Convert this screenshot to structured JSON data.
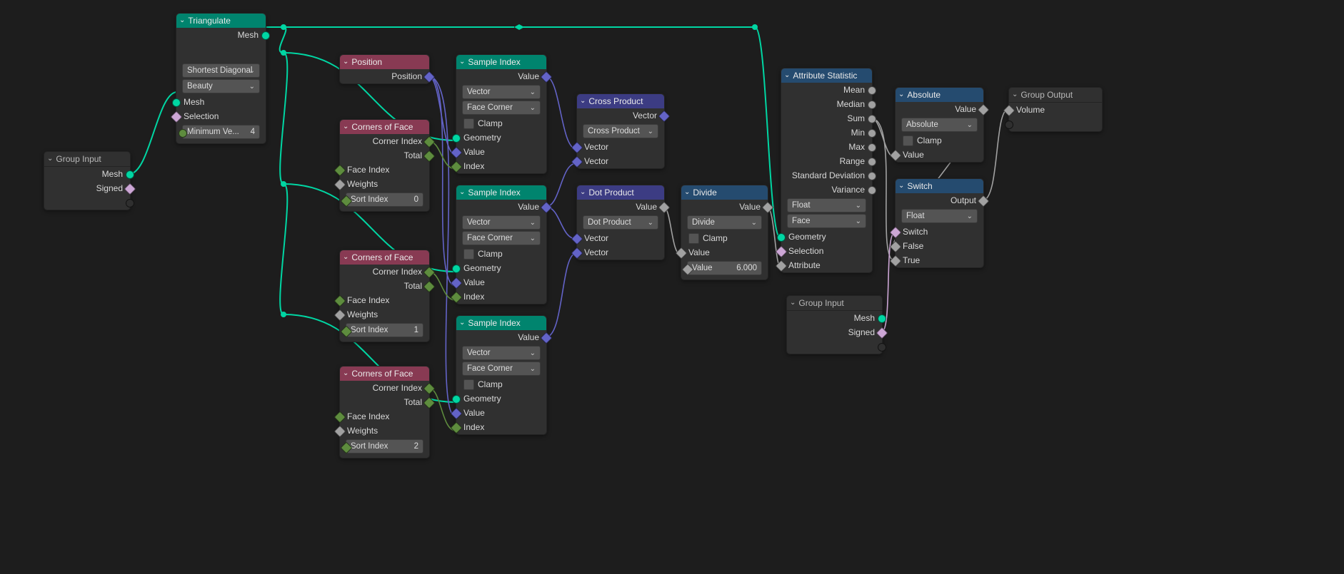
{
  "nodes": {
    "groupInput1": {
      "title": "Group Input",
      "outs": [
        "Mesh",
        "Signed"
      ]
    },
    "triangulate": {
      "title": "Triangulate",
      "outMesh": "Mesh",
      "ddQuad": "Shortest Diagonal",
      "ddNgon": "Beauty",
      "inMesh": "Mesh",
      "inSel": "Selection",
      "fieldMin": {
        "label": "Minimum Ve...",
        "value": "4"
      }
    },
    "position": {
      "title": "Position",
      "out": "Position"
    },
    "corners1": {
      "title": "Corners of Face",
      "outIdx": "Corner Index",
      "outTot": "Total",
      "inFace": "Face Index",
      "inWeights": "Weights",
      "sort": {
        "label": "Sort Index",
        "value": "0"
      }
    },
    "corners2": {
      "title": "Corners of Face",
      "outIdx": "Corner Index",
      "outTot": "Total",
      "inFace": "Face Index",
      "inWeights": "Weights",
      "sort": {
        "label": "Sort Index",
        "value": "1"
      }
    },
    "corners3": {
      "title": "Corners of Face",
      "outIdx": "Corner Index",
      "outTot": "Total",
      "inFace": "Face Index",
      "inWeights": "Weights",
      "sort": {
        "label": "Sort Index",
        "value": "2"
      }
    },
    "sample1": {
      "title": "Sample Index",
      "out": "Value",
      "ddType": "Vector",
      "ddDomain": "Face Corner",
      "clamp": "Clamp",
      "inGeom": "Geometry",
      "inVal": "Value",
      "inIdx": "Index"
    },
    "sample2": {
      "title": "Sample Index",
      "out": "Value",
      "ddType": "Vector",
      "ddDomain": "Face Corner",
      "clamp": "Clamp",
      "inGeom": "Geometry",
      "inVal": "Value",
      "inIdx": "Index"
    },
    "sample3": {
      "title": "Sample Index",
      "out": "Value",
      "ddType": "Vector",
      "ddDomain": "Face Corner",
      "clamp": "Clamp",
      "inGeom": "Geometry",
      "inVal": "Value",
      "inIdx": "Index"
    },
    "cross": {
      "title": "Cross Product",
      "out": "Vector",
      "dd": "Cross Product",
      "in1": "Vector",
      "in2": "Vector"
    },
    "dot": {
      "title": "Dot Product",
      "out": "Value",
      "dd": "Dot Product",
      "in1": "Vector",
      "in2": "Vector"
    },
    "divide": {
      "title": "Divide",
      "out": "Value",
      "dd": "Divide",
      "clamp": "Clamp",
      "inVal": "Value",
      "const": {
        "label": "Value",
        "value": "6.000"
      }
    },
    "attrStat": {
      "title": "Attribute Statistic",
      "outs": [
        "Mean",
        "Median",
        "Sum",
        "Min",
        "Max",
        "Range",
        "Standard Deviation",
        "Variance"
      ],
      "ddType": "Float",
      "ddDomain": "Face",
      "inGeom": "Geometry",
      "inSel": "Selection",
      "inAttr": "Attribute"
    },
    "abs": {
      "title": "Absolute",
      "out": "Value",
      "dd": "Absolute",
      "clamp": "Clamp",
      "in": "Value"
    },
    "switch": {
      "title": "Switch",
      "out": "Output",
      "dd": "Float",
      "inSwitch": "Switch",
      "inFalse": "False",
      "inTrue": "True"
    },
    "groupInput2": {
      "title": "Group Input",
      "outMesh": "Mesh",
      "outSigned": "Signed"
    },
    "groupOutput": {
      "title": "Group Output",
      "in": "Volume"
    }
  }
}
